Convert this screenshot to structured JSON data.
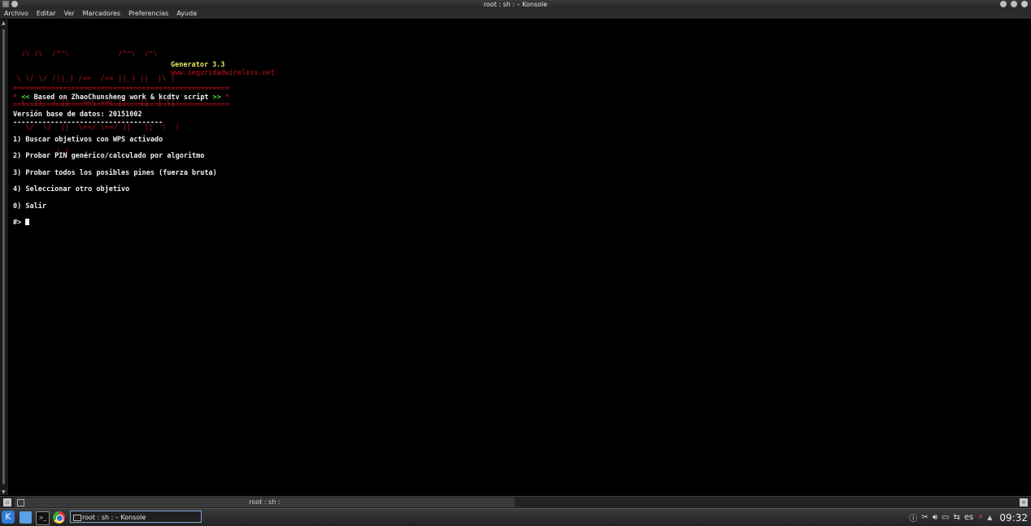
{
  "window": {
    "title": "root : sh : – Konsole"
  },
  "menubar": {
    "items": [
      "Archivo",
      "Editar",
      "Ver",
      "Marcadores",
      "Preferencias",
      "Ayuda"
    ]
  },
  "terminal": {
    "logo_lines": [
      "  /\\ /\\  /^^\\           /^^\\  /^\\",
      " \\ \\/ \\/ /||_) /==  /== ||_) ||  |\\ |",
      "  \\  /\\  / ||   ==\\ ==\\ ||   ||  | \\|",
      "   \\/  \\/  ||  \\==/ \\==/ ||   ||  |  |",
      "          |_|"
    ],
    "generator": "Generator 3.3",
    "website": "www.seguridadwireless.net",
    "separator_red": "====================================================",
    "banner_prefix": "* ",
    "banner_open": "<<",
    "banner_text": " Based on ZhaoChunsheng work & kcdtv script ",
    "banner_close": ">>",
    "banner_suffix": " *",
    "db_version": "Versión base de datos: 20151002",
    "dashes": "------------------------------------",
    "options": [
      "1) Buscar objetivos con WPS activado",
      "2) Probar PIN genérico/calculado por algoritmo",
      "3) Probar todos los posibles pines (fuerza bruta)",
      "4) Seleccionar otro objetivo",
      "0) Salir"
    ],
    "prompt": "#> "
  },
  "tabbar": {
    "tab_label": "root : sh :"
  },
  "panel": {
    "task_label": "root : sh : – Konsole",
    "language": "es",
    "clock": "09:32"
  }
}
